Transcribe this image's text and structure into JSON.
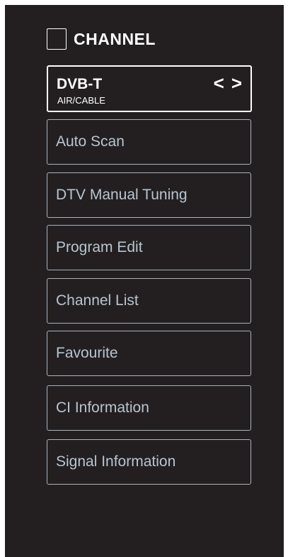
{
  "header": {
    "title": "CHANNEL",
    "icon": "square-outline-icon"
  },
  "selector": {
    "value": "DVB-T",
    "subtitle": "AIR/CABLE",
    "prev_glyph": "<",
    "next_glyph": ">"
  },
  "menu": [
    {
      "label": "Auto Scan"
    },
    {
      "label": "DTV Manual Tuning"
    },
    {
      "label": "Program Edit"
    },
    {
      "label": "Channel List"
    },
    {
      "label": "Favourite"
    },
    {
      "label": "CI Information"
    },
    {
      "label": "Signal Information"
    }
  ],
  "colors": {
    "background": "#231f20",
    "item_text": "#b7c5d1",
    "item_border": "#aab3bd",
    "highlight": "#ffffff"
  }
}
